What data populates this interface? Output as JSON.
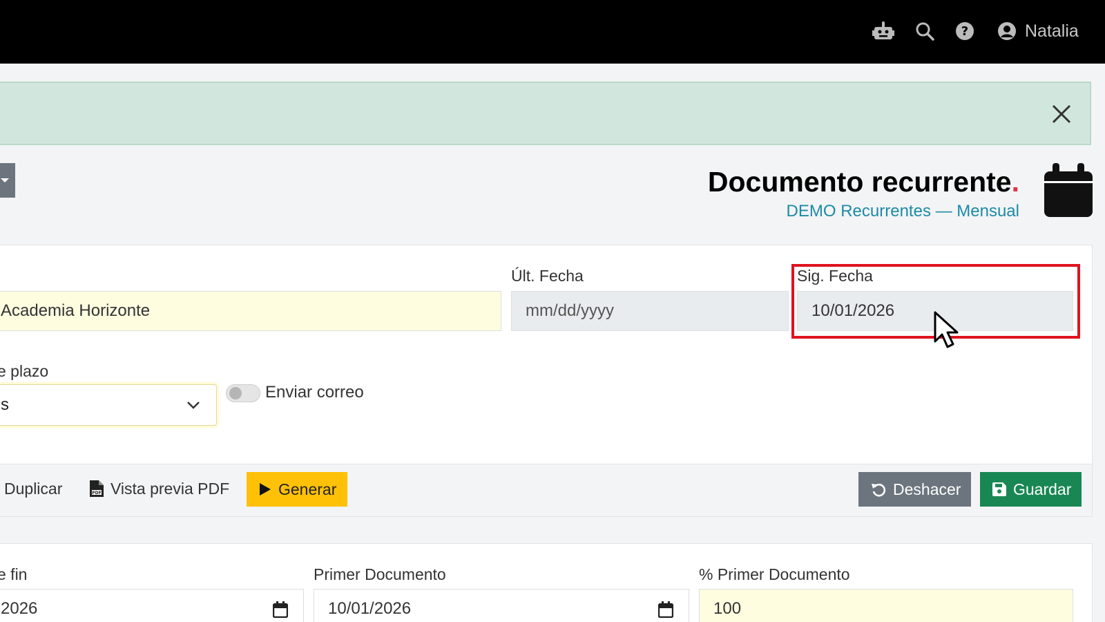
{
  "topbar": {
    "user_name": "Natalia"
  },
  "header": {
    "title": "Documento recurrente",
    "title_dot": ".",
    "subtitle": "DEMO Recurrentes — Mensual"
  },
  "form": {
    "client_value": "Academia Horizonte",
    "ult_fecha_label": "Últ. Fecha",
    "ult_fecha_placeholder": "mm/dd/yyyy",
    "sig_fecha_label": "Sig. Fecha",
    "sig_fecha_value": "10/01/2026",
    "plazo_label": "e plazo",
    "plazo_value": "s",
    "enviar_correo_label": "Enviar correo",
    "enviar_correo_on": false
  },
  "actions": {
    "duplicar": "Duplicar",
    "vista_previa": "Vista previa PDF",
    "generar": "Generar",
    "deshacer": "Deshacer",
    "guardar": "Guardar"
  },
  "form2": {
    "fin_label": "e fin",
    "fin_value": "2026",
    "primer_doc_label": "Primer Documento",
    "primer_doc_value": "10/01/2026",
    "pct_primer_doc_label": "% Primer Documento",
    "pct_primer_doc_value": "100"
  },
  "colors": {
    "accent_yellow": "#ffc107",
    "save_green": "#198754",
    "undo_gray": "#6c757d",
    "alert_green": "#d1e7dd",
    "subtitle_teal": "#1d8aa6",
    "highlight_red": "#e0121f"
  },
  "icons": [
    "robot-icon",
    "search-icon",
    "help-icon",
    "user-circle-icon",
    "close-icon",
    "calendar-icon",
    "chevron-down-icon",
    "file-pdf-icon",
    "play-icon",
    "undo-icon",
    "save-icon",
    "mouse-cursor-icon"
  ]
}
